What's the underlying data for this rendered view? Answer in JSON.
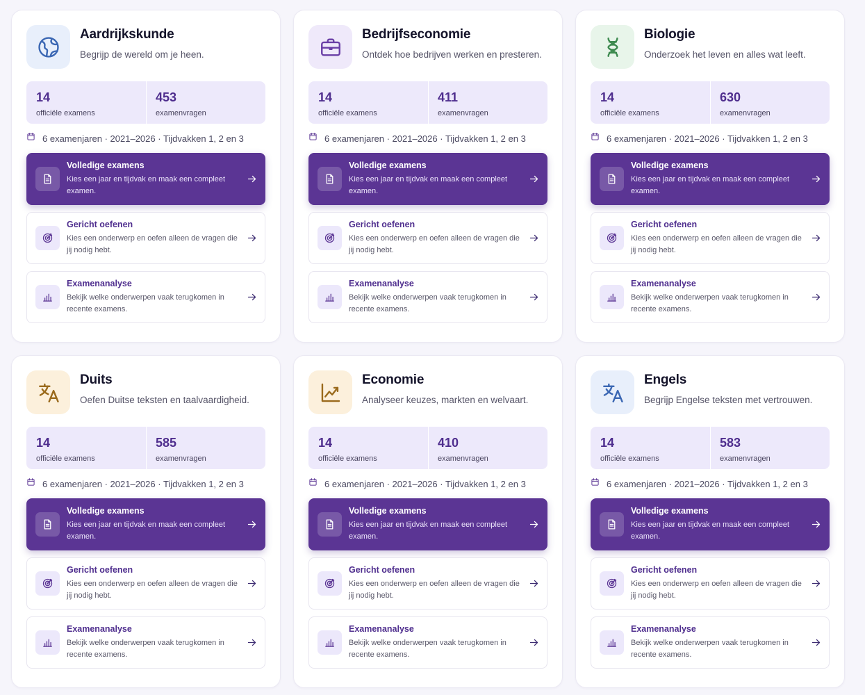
{
  "accent": "#5b3594",
  "actions": {
    "full": {
      "title": "Volledige examens",
      "desc": "Kies een jaar en tijdvak en maak een compleet examen.",
      "icon": "document-icon"
    },
    "practice": {
      "title": "Gericht oefenen",
      "desc": "Kies een onderwerp en oefen alleen de vragen die jij nodig hebt.",
      "icon": "target-icon"
    },
    "analysis": {
      "title": "Examenanalyse",
      "desc": "Bekijk welke onderwerpen vaak terugkomen in recente examens.",
      "icon": "bar-chart-icon"
    }
  },
  "subjects": [
    {
      "title": "Aardrijkskunde",
      "desc": "Begrijp de wereld om je heen.",
      "icon": "globe-icon",
      "icon_color": "#3b67b3",
      "icon_bg": "#e8effb",
      "exams": "14",
      "exams_label": "officiële examens",
      "questions": "453",
      "questions_label": "examenvragen",
      "years": "6 examenjaren · 2021–2026 · Tijdvakken 1, 2 en 3"
    },
    {
      "title": "Bedrijfseconomie",
      "desc": "Ontdek hoe bedrijven werken en presteren.",
      "icon": "briefcase-icon",
      "icon_color": "#6a3fa6",
      "icon_bg": "#efe9fa",
      "exams": "14",
      "exams_label": "officiële examens",
      "questions": "411",
      "questions_label": "examenvragen",
      "years": "6 examenjaren · 2021–2026 · Tijdvakken 1, 2 en 3"
    },
    {
      "title": "Biologie",
      "desc": "Onderzoek het leven en alles wat leeft.",
      "icon": "dna-icon",
      "icon_color": "#3d8a4f",
      "icon_bg": "#e8f5ea",
      "exams": "14",
      "exams_label": "officiële examens",
      "questions": "630",
      "questions_label": "examenvragen",
      "years": "6 examenjaren · 2021–2026 · Tijdvakken 1, 2 en 3"
    },
    {
      "title": "Duits",
      "desc": "Oefen Duitse teksten en taalvaardigheid.",
      "icon": "translate-icon",
      "icon_color": "#9a6a1c",
      "icon_bg": "#fcf0dc",
      "exams": "14",
      "exams_label": "officiële examens",
      "questions": "585",
      "questions_label": "examenvragen",
      "years": "6 examenjaren · 2021–2026 · Tijdvakken 1, 2 en 3"
    },
    {
      "title": "Economie",
      "desc": "Analyseer keuzes, markten en welvaart.",
      "icon": "trend-chart-icon",
      "icon_color": "#9a6a1c",
      "icon_bg": "#fcf0dc",
      "exams": "14",
      "exams_label": "officiële examens",
      "questions": "410",
      "questions_label": "examenvragen",
      "years": "6 examenjaren · 2021–2026 · Tijdvakken 1, 2 en 3"
    },
    {
      "title": "Engels",
      "desc": "Begrijp Engelse teksten met vertrouwen.",
      "icon": "translate-icon",
      "icon_color": "#3b67b3",
      "icon_bg": "#e8effb",
      "exams": "14",
      "exams_label": "officiële examens",
      "questions": "583",
      "questions_label": "examenvragen",
      "years": "6 examenjaren · 2021–2026 · Tijdvakken 1, 2 en 3"
    }
  ]
}
